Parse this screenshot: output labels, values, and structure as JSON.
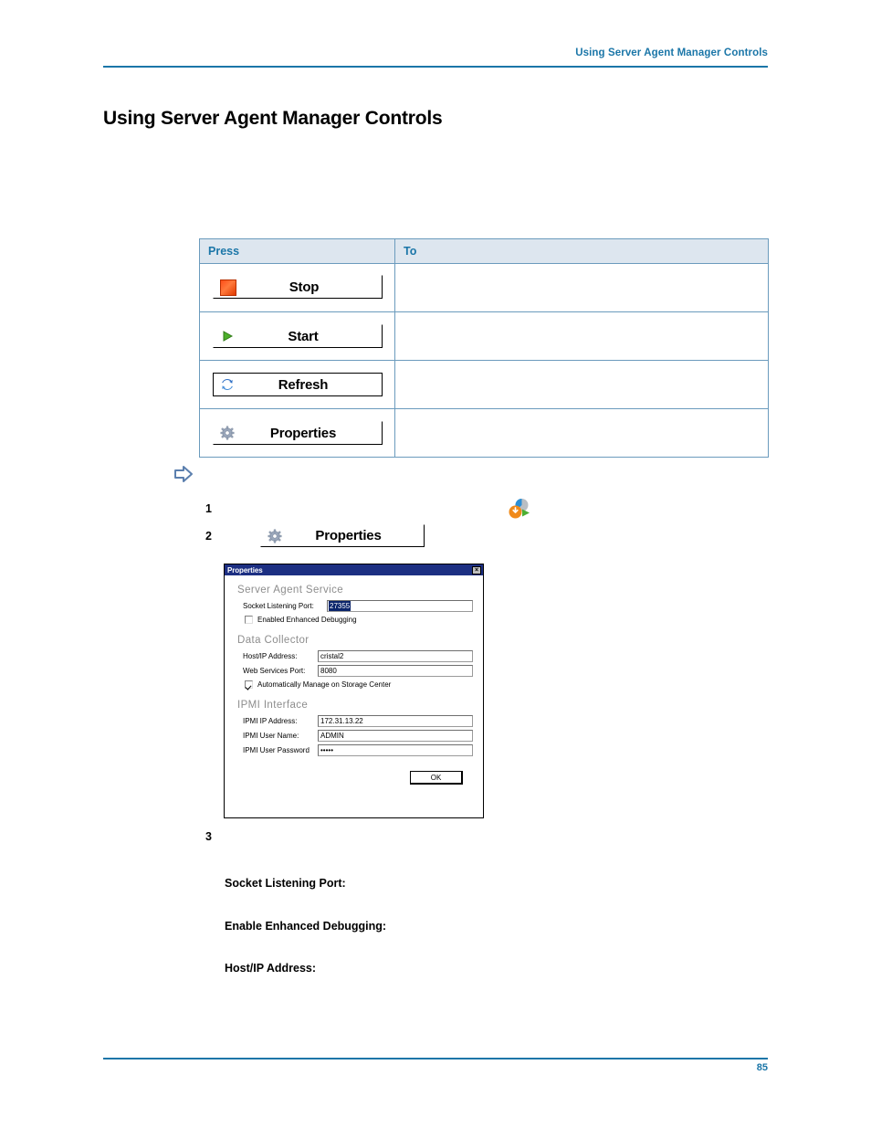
{
  "header": {
    "running_head": "Using Server Agent Manager Controls",
    "rule_color": "#1b76a8"
  },
  "page_title": "Using Server Agent Manager Controls",
  "controls_table": {
    "columns": [
      "Press",
      "To"
    ],
    "rows": [
      {
        "press_label": "Stop",
        "press_icon": "stop-square-icon",
        "to": ""
      },
      {
        "press_label": "Start",
        "press_icon": "play-triangle-icon",
        "to": ""
      },
      {
        "press_label": "Refresh",
        "press_icon": "refresh-arrows-icon",
        "to": ""
      },
      {
        "press_label": "Properties",
        "press_icon": "gear-icon",
        "to": ""
      }
    ]
  },
  "procedure": {
    "arrow_bullet_icon": "right-arrow-bullet-icon",
    "steps": [
      {
        "number": "1",
        "text": "",
        "trailing_icon": "server-agent-status-icon"
      },
      {
        "number": "2",
        "text": "",
        "button_label": "Properties",
        "button_icon": "gear-icon"
      },
      {
        "number": "3",
        "text": ""
      }
    ]
  },
  "dialog": {
    "title": "Properties",
    "close_icon": "close-icon",
    "groups": [
      {
        "heading": "Server Agent Service",
        "fields": [
          {
            "label": "Socket Listening Port:",
            "value": "27355",
            "selected": true
          }
        ],
        "checkboxes": [
          {
            "label": "Enabled Enhanced Debugging",
            "checked": false
          }
        ]
      },
      {
        "heading": "Data Collector",
        "fields": [
          {
            "label": "Host/IP Address:",
            "value": "cristal2"
          },
          {
            "label": "Web Services Port:",
            "value": "8080"
          }
        ],
        "checkboxes": [
          {
            "label": "Automatically Manage on Storage Center",
            "checked": true
          }
        ]
      },
      {
        "heading": "IPMI Interface",
        "fields": [
          {
            "label": "IPMI IP Address:",
            "value": "172.31.13.22"
          },
          {
            "label": "IPMI User Name:",
            "value": "ADMIN"
          },
          {
            "label": "IPMI User Password",
            "value": "•••••"
          }
        ],
        "checkboxes": []
      }
    ],
    "ok_label": "OK"
  },
  "definition_terms": [
    "Socket Listening Port:",
    "Enable Enhanced Debugging:",
    "Host/IP Address:"
  ],
  "footer": {
    "page_number": "85"
  }
}
